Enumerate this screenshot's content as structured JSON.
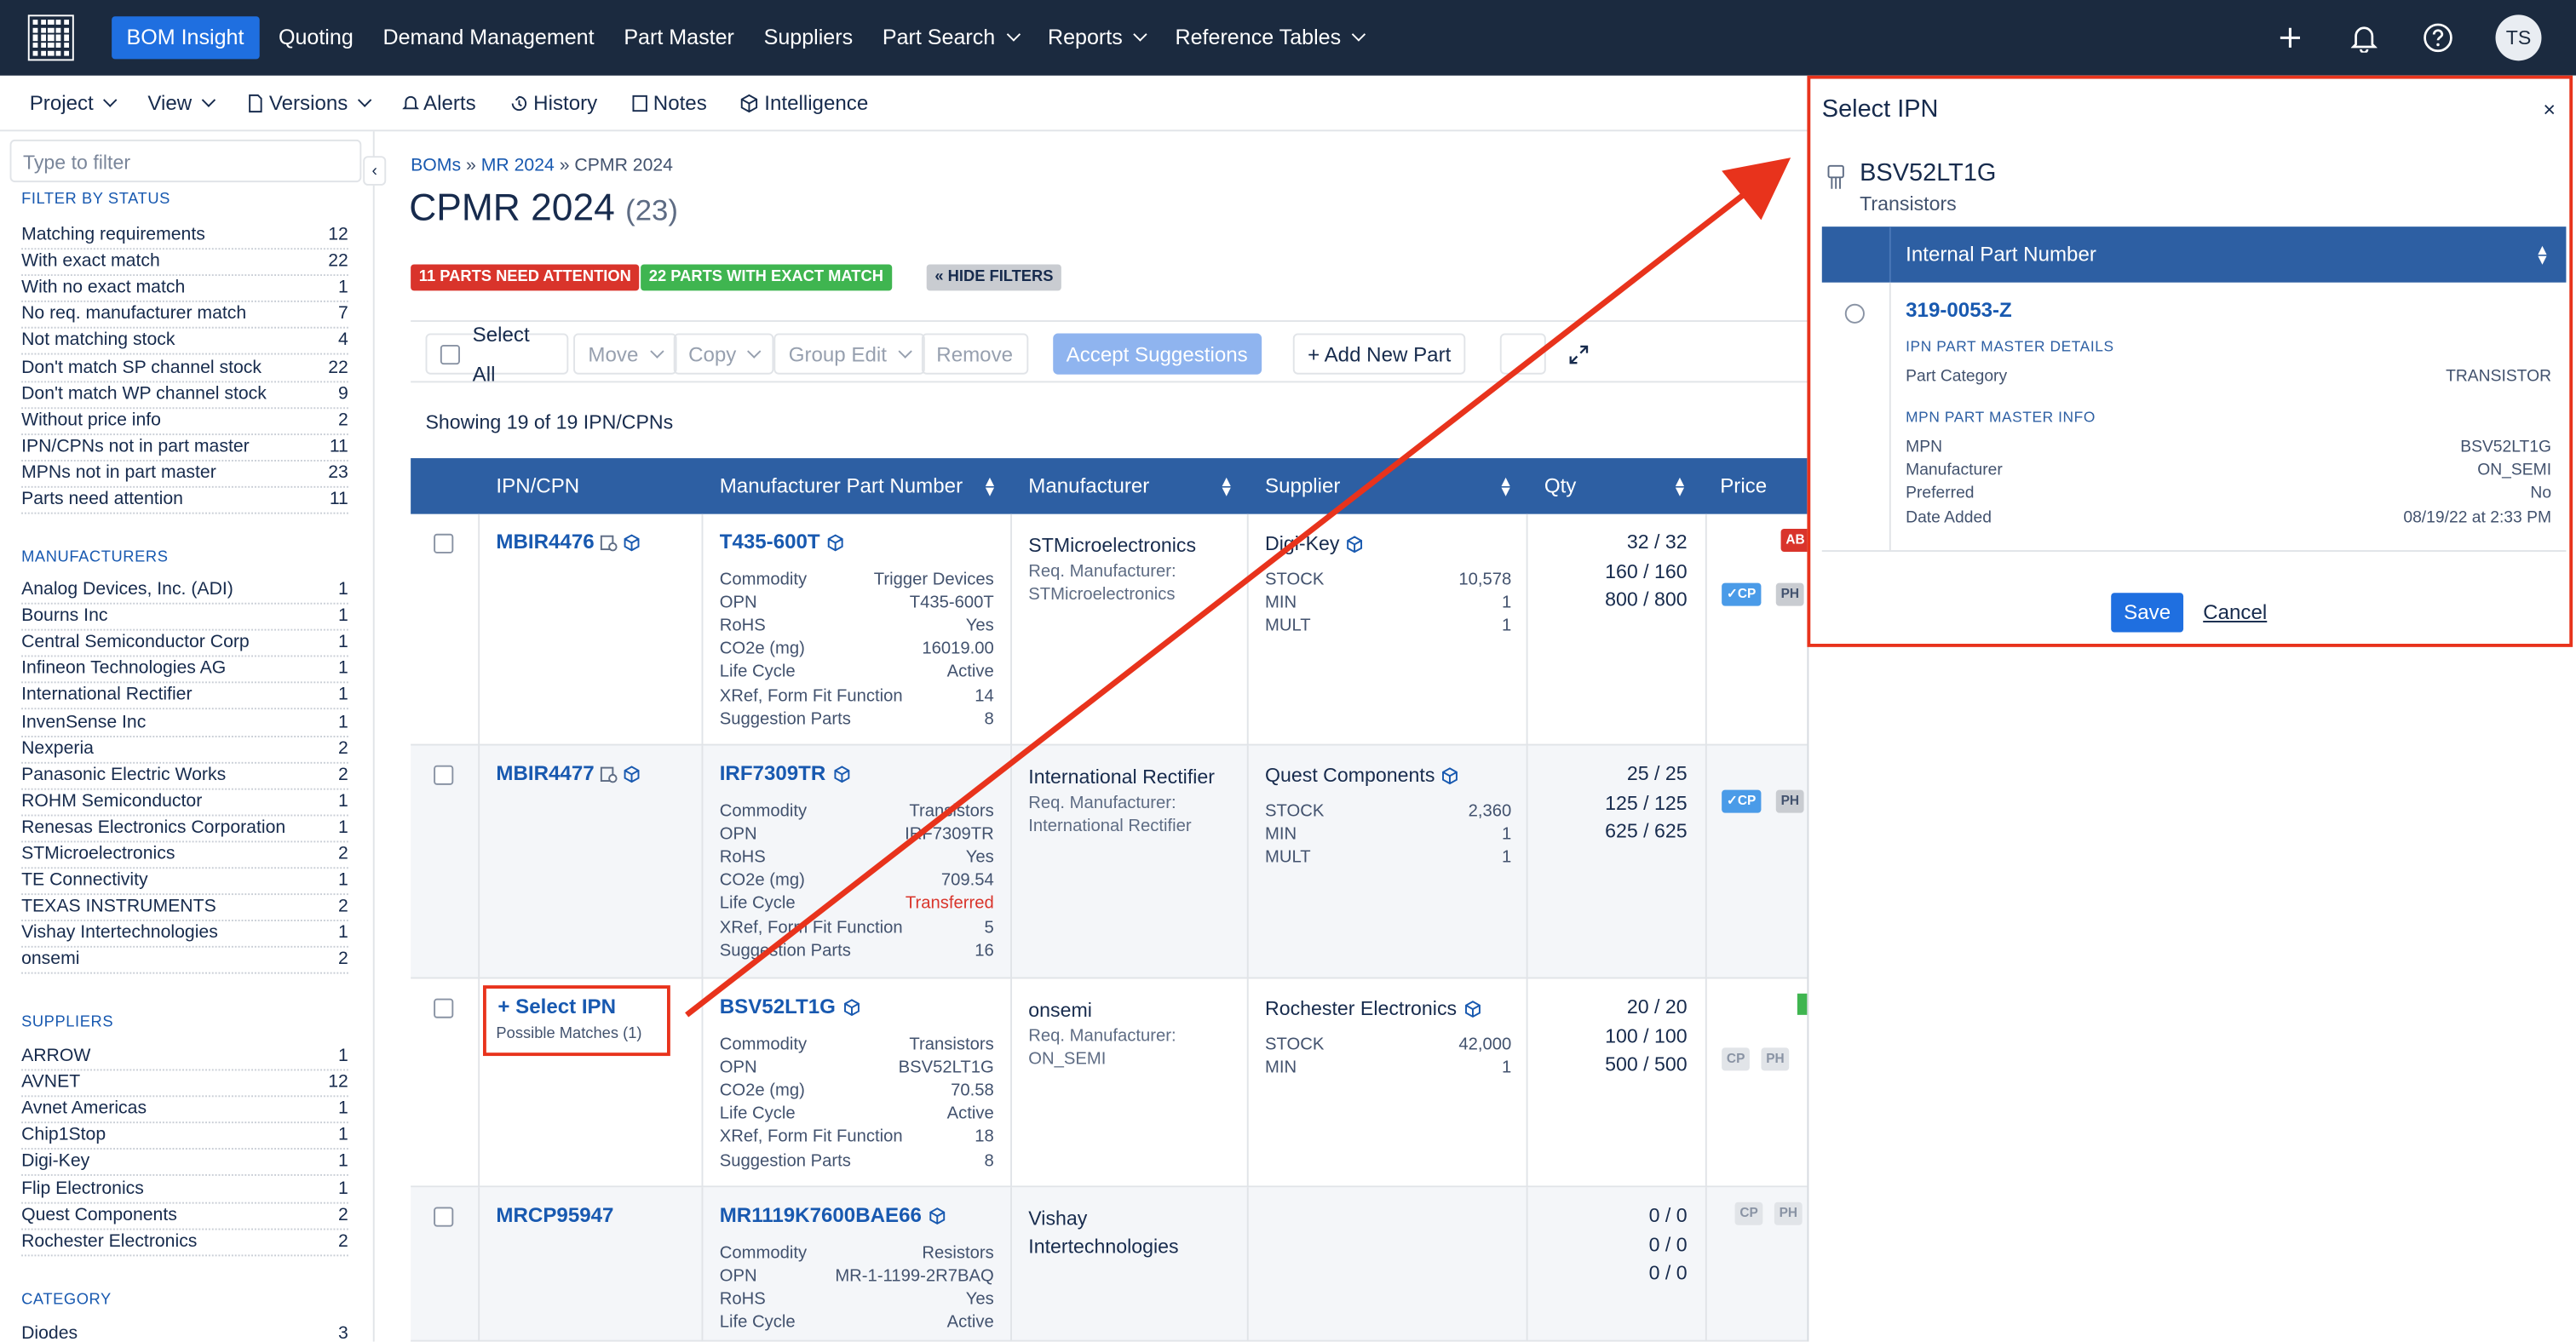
{
  "topnav": {
    "items": [
      "BOM Insight",
      "Quoting",
      "Demand Management",
      "Part Master",
      "Suppliers",
      "Part Search",
      "Reports",
      "Reference Tables"
    ],
    "user_initials": "TS"
  },
  "subnav": {
    "items": [
      "Project",
      "View",
      "Versions",
      "Alerts",
      "History",
      "Notes",
      "Intelligence"
    ]
  },
  "sidebar": {
    "filter_placeholder": "Type to filter",
    "status_header": "FILTER BY STATUS",
    "status": [
      {
        "label": "Matching requirements",
        "count": "12"
      },
      {
        "label": "With exact match",
        "count": "22"
      },
      {
        "label": "With no exact match",
        "count": "1"
      },
      {
        "label": "No req. manufacturer match",
        "count": "7"
      },
      {
        "label": "Not matching stock",
        "count": "4"
      },
      {
        "label": "Don't match SP channel stock",
        "count": "22"
      },
      {
        "label": "Don't match WP channel stock",
        "count": "9"
      },
      {
        "label": "Without price info",
        "count": "2"
      },
      {
        "label": "IPN/CPNs not in part master",
        "count": "11"
      },
      {
        "label": "MPNs not in part master",
        "count": "23"
      },
      {
        "label": "Parts need attention",
        "count": "11"
      }
    ],
    "manufacturers_header": "MANUFACTURERS",
    "manufacturers": [
      {
        "label": "Analog Devices, Inc. (ADI)",
        "count": "1"
      },
      {
        "label": "Bourns Inc",
        "count": "1"
      },
      {
        "label": "Central Semiconductor Corp",
        "count": "1"
      },
      {
        "label": "Infineon Technologies AG",
        "count": "1"
      },
      {
        "label": "International Rectifier",
        "count": "1"
      },
      {
        "label": "InvenSense Inc",
        "count": "1"
      },
      {
        "label": "Nexperia",
        "count": "2"
      },
      {
        "label": "Panasonic Electric Works",
        "count": "2"
      },
      {
        "label": "ROHM Semiconductor",
        "count": "1"
      },
      {
        "label": "Renesas Electronics Corporation",
        "count": "1"
      },
      {
        "label": "STMicroelectronics",
        "count": "2"
      },
      {
        "label": "TE Connectivity",
        "count": "1"
      },
      {
        "label": "TEXAS INSTRUMENTS",
        "count": "2"
      },
      {
        "label": "Vishay Intertechnologies",
        "count": "1"
      },
      {
        "label": "onsemi",
        "count": "2"
      }
    ],
    "suppliers_header": "SUPPLIERS",
    "suppliers": [
      {
        "label": "ARROW",
        "count": "1"
      },
      {
        "label": "AVNET",
        "count": "12"
      },
      {
        "label": "Avnet Americas",
        "count": "1"
      },
      {
        "label": "Chip1Stop",
        "count": "1"
      },
      {
        "label": "Digi-Key",
        "count": "1"
      },
      {
        "label": "Flip Electronics",
        "count": "1"
      },
      {
        "label": "Quest Components",
        "count": "2"
      },
      {
        "label": "Rochester Electronics",
        "count": "2"
      }
    ],
    "category_header": "CATEGORY",
    "category": [
      {
        "label": "Diodes",
        "count": "3"
      }
    ]
  },
  "breadcrumb": {
    "boms": "BOMs",
    "sep": "»",
    "mr": "MR 2024",
    "current": "CPMR 2024"
  },
  "page": {
    "title": "CPMR 2024",
    "count": "(23)"
  },
  "badges": {
    "attention": "11 PARTS NEED ATTENTION",
    "exact": "22 PARTS WITH EXACT MATCH",
    "hide": "« HIDE FILTERS"
  },
  "toolbar": {
    "select_all": "Select All",
    "move": "Move",
    "copy": "Copy",
    "group_edit": "Group Edit",
    "remove": "Remove",
    "accept": "Accept Suggestions",
    "add_new": "+ Add New Part"
  },
  "showing": "Showing 19 of 19 IPN/CPNs",
  "table": {
    "headers": [
      "IPN/CPN",
      "Manufacturer Part Number",
      "Manufacturer",
      "Supplier",
      "Qty",
      "Price"
    ],
    "rows": [
      {
        "ipn": "MBIR4476",
        "mpn": "T435-600T",
        "details": [
          [
            "Commodity",
            "Trigger Devices"
          ],
          [
            "OPN",
            "T435-600T"
          ],
          [
            "RoHS",
            "Yes"
          ],
          [
            "CO2e (mg)",
            "16019.00"
          ],
          [
            "Life Cycle",
            "Active"
          ],
          [
            "XRef, Form Fit Function",
            "14"
          ],
          [
            "Suggestion Parts",
            "8"
          ]
        ],
        "manufacturer": "STMicroelectronics",
        "req_label": "Req. Manufacturer:",
        "req": "STMicroelectronics",
        "supplier": "Digi-Key",
        "sup_details": [
          [
            "STOCK",
            "10,578"
          ],
          [
            "MIN",
            "1"
          ],
          [
            "MULT",
            "1"
          ]
        ],
        "qty": [
          "32 / 32",
          "160 / 160",
          "800 / 800"
        ],
        "pills": [
          "AB",
          "✓CP",
          "PH"
        ]
      },
      {
        "ipn": "MBIR4477",
        "mpn": "IRF7309TR",
        "details": [
          [
            "Commodity",
            "Transistors"
          ],
          [
            "OPN",
            "IRF7309TR"
          ],
          [
            "RoHS",
            "Yes"
          ],
          [
            "CO2e (mg)",
            "709.54"
          ],
          [
            "Life Cycle",
            "Transferred"
          ],
          [
            "XRef, Form Fit Function",
            "5"
          ],
          [
            "Suggestion Parts",
            "16"
          ]
        ],
        "manufacturer": "International Rectifier",
        "req_label": "Req. Manufacturer:",
        "req": "International Rectifier",
        "supplier": "Quest Components",
        "sup_details": [
          [
            "STOCK",
            "2,360"
          ],
          [
            "MIN",
            "1"
          ],
          [
            "MULT",
            "1"
          ]
        ],
        "qty": [
          "25 / 25",
          "125 / 125",
          "625 / 625"
        ],
        "pills": [
          "✓CP",
          "PH"
        ]
      },
      {
        "ipn": "+ Select IPN",
        "possible": "Possible Matches (1)",
        "mpn": "BSV52LT1G",
        "details": [
          [
            "Commodity",
            "Transistors"
          ],
          [
            "OPN",
            "BSV52LT1G"
          ],
          [
            "CO2e (mg)",
            "70.58"
          ],
          [
            "Life Cycle",
            "Active"
          ],
          [
            "XRef, Form Fit Function",
            "18"
          ],
          [
            "Suggestion Parts",
            "8"
          ]
        ],
        "manufacturer": "onsemi",
        "req_label": "Req. Manufacturer:",
        "req": "ON_SEMI",
        "supplier": "Rochester Electronics",
        "sup_details": [
          [
            "STOCK",
            "42,000"
          ],
          [
            "MIN",
            "1"
          ]
        ],
        "qty": [
          "20 / 20",
          "100 / 100",
          "500 / 500"
        ],
        "pills": [
          "CP",
          "PH"
        ]
      },
      {
        "ipn": "MRCP95947",
        "mpn": "MR1119K7600BAE66",
        "details": [
          [
            "Commodity",
            "Resistors"
          ],
          [
            "OPN",
            "MR-1-1199-2R7BAQ"
          ],
          [
            "RoHS",
            "Yes"
          ],
          [
            "Life Cycle",
            "Active"
          ]
        ],
        "manufacturer": "Vishay Intertechnologies",
        "req_label": "",
        "req": "",
        "supplier": "",
        "sup_details": [],
        "qty": [
          "0 / 0",
          "0 / 0",
          "0 / 0"
        ],
        "pills": [
          "CP",
          "PH"
        ]
      }
    ]
  },
  "panel": {
    "title": "Select IPN",
    "close": "×",
    "mpn": "BSV52LT1G",
    "category": "Transistors",
    "table_header": "Internal Part Number",
    "option": "319-0053-Z",
    "ipn_section": "IPN PART MASTER DETAILS",
    "ipn_details": [
      [
        "Part Category",
        "TRANSISTOR"
      ]
    ],
    "mpn_section": "MPN PART MASTER INFO",
    "mpn_details": [
      [
        "MPN",
        "BSV52LT1G"
      ],
      [
        "Manufacturer",
        "ON_SEMI"
      ],
      [
        "Preferred",
        "No"
      ],
      [
        "Date Added",
        "08/19/22 at 2:33 PM"
      ]
    ],
    "save": "Save",
    "cancel": "Cancel"
  },
  "colors": {
    "nav_bg": "#1b2a3f",
    "accent": "#1f6fe0",
    "header_bg": "#2d5fa3",
    "attention": "#d9342b",
    "exact": "#3fb550",
    "annotation": "#e8331c"
  }
}
